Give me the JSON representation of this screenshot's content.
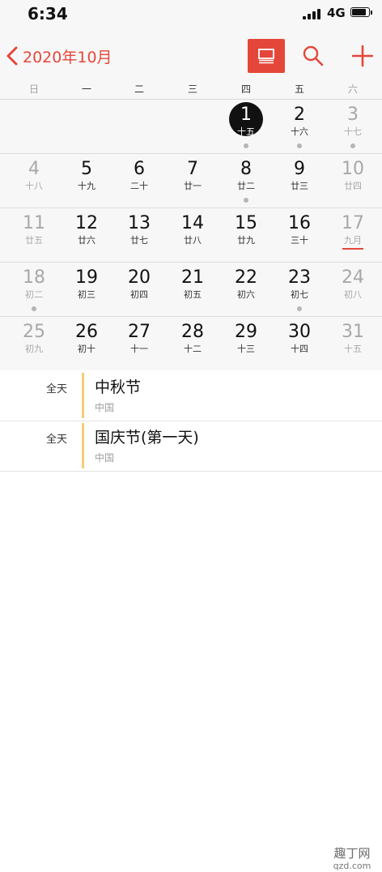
{
  "status_bar": {
    "time": "6:34",
    "network": "4G",
    "battery_level": 0.9
  },
  "nav": {
    "month_label": "2020年10月",
    "accent_color": "#e4473a"
  },
  "weekdays": [
    "日",
    "一",
    "二",
    "三",
    "四",
    "五",
    "六"
  ],
  "weeks": [
    [
      null,
      null,
      null,
      null,
      {
        "day": "1",
        "lunar": "十五",
        "today": true,
        "dot": true
      },
      {
        "day": "2",
        "lunar": "十六",
        "dot": true
      },
      {
        "day": "3",
        "lunar": "十七",
        "dot": true
      }
    ],
    [
      {
        "day": "4",
        "lunar": "十八"
      },
      {
        "day": "5",
        "lunar": "十九"
      },
      {
        "day": "6",
        "lunar": "二十"
      },
      {
        "day": "7",
        "lunar": "廿一"
      },
      {
        "day": "8",
        "lunar": "廿二",
        "dot": true
      },
      {
        "day": "9",
        "lunar": "廿三"
      },
      {
        "day": "10",
        "lunar": "廿四"
      }
    ],
    [
      {
        "day": "11",
        "lunar": "廿五"
      },
      {
        "day": "12",
        "lunar": "廿六"
      },
      {
        "day": "13",
        "lunar": "廿七"
      },
      {
        "day": "14",
        "lunar": "廿八"
      },
      {
        "day": "15",
        "lunar": "廿九"
      },
      {
        "day": "16",
        "lunar": "三十"
      },
      {
        "day": "17",
        "lunar": "九月",
        "underline": true
      }
    ],
    [
      {
        "day": "18",
        "lunar": "初二",
        "dot": true
      },
      {
        "day": "19",
        "lunar": "初三"
      },
      {
        "day": "20",
        "lunar": "初四"
      },
      {
        "day": "21",
        "lunar": "初五"
      },
      {
        "day": "22",
        "lunar": "初六"
      },
      {
        "day": "23",
        "lunar": "初七",
        "dot": true
      },
      {
        "day": "24",
        "lunar": "初八"
      }
    ],
    [
      {
        "day": "25",
        "lunar": "初九"
      },
      {
        "day": "26",
        "lunar": "初十"
      },
      {
        "day": "27",
        "lunar": "十一"
      },
      {
        "day": "28",
        "lunar": "十二"
      },
      {
        "day": "29",
        "lunar": "十三"
      },
      {
        "day": "30",
        "lunar": "十四"
      },
      {
        "day": "31",
        "lunar": "十五"
      }
    ]
  ],
  "events": [
    {
      "allday": "全天",
      "title": "中秋节",
      "subtitle": "中国"
    },
    {
      "allday": "全天",
      "title": "国庆节(第一天)",
      "subtitle": "中国"
    }
  ],
  "watermark": {
    "line1": "趣丁网",
    "line2": "qzd.com"
  }
}
